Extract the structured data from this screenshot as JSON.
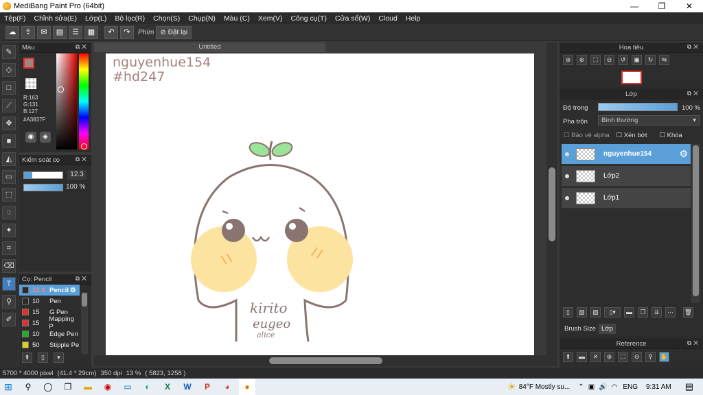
{
  "window": {
    "title": "MediBang Paint Pro (64bit)",
    "min": "—",
    "max": "❐",
    "close": "✕"
  },
  "menu": [
    "Tệp(F)",
    "Chỉnh sửa(E)",
    "Lớp(L)",
    "Bộ lọc(R)",
    "Chọn(S)",
    "Chụp(N)",
    "Màu (C)",
    "Xem(V)",
    "Công cụ(T)",
    "Cửa sổ(W)",
    "Cloud",
    "Help"
  ],
  "toolbar": {
    "shortcut_label": "Phím",
    "reset_label": "Đặt lại"
  },
  "color_panel": {
    "title": "Màu",
    "r": "R:163",
    "g": "G:131",
    "b": "B:127",
    "hex": "#A3837F",
    "primary": "#A3837F"
  },
  "brush_control": {
    "title": "Kiểm soát cọ",
    "size": "12.3",
    "opacity": "100 %"
  },
  "brush_panel": {
    "title": "Cọ: Pencil",
    "items": [
      {
        "size": "12.3",
        "name": "Pencil",
        "color": "#2a2a2a"
      },
      {
        "size": "10",
        "name": "Pen",
        "color": "#2a2a2a"
      },
      {
        "size": "15",
        "name": "G Pen",
        "color": "#e03030"
      },
      {
        "size": "15",
        "name": "Mapping P",
        "color": "#e03030"
      },
      {
        "size": "10",
        "name": "Edge Pen",
        "color": "#20b020"
      },
      {
        "size": "50",
        "name": "Stipple Pe",
        "color": "#e0d020"
      }
    ]
  },
  "document": {
    "tab_title": "Untitled",
    "text_line1": "nguyenhue154",
    "text_line2": "#hd247",
    "signature_line1": "kirito",
    "signature_line2": "eugeo",
    "signature_line3": "alice"
  },
  "navigator": {
    "title": "Hoa tiêu"
  },
  "layer_panel": {
    "title": "Lớp",
    "opacity_label": "Độ trong",
    "opacity_value": "100 %",
    "blend_label": "Pha trộn",
    "blend_value": "Bình thường",
    "protect_alpha": "Bảo vệ alpha",
    "clipping": "Xén bớt",
    "lock": "Khóa",
    "layers": [
      "nguyenhue154",
      "Lớp2",
      "Lớp1"
    ],
    "tab_brush_size": "Brush Size",
    "tab_layer": "Lớp"
  },
  "reference": {
    "title": "Reference"
  },
  "status": {
    "size": "5700 * 4000 pixel",
    "cm": "(41.4 * 29cm)",
    "dpi": "350 dpi",
    "zoom": "13 %",
    "coords": "( 5823, 1258 )"
  },
  "taskbar": {
    "weather": "84°F  Mostly su...",
    "lang": "ENG",
    "time": "9:31 AM"
  }
}
